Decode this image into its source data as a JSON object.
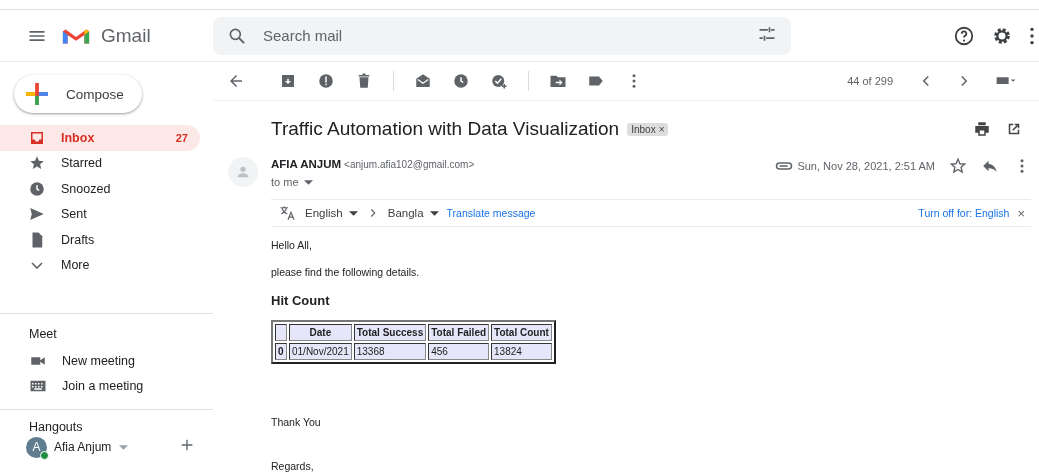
{
  "header": {
    "app_name": "Gmail",
    "search": {
      "placeholder": "Search mail"
    }
  },
  "sidebar": {
    "compose": "Compose",
    "items": [
      {
        "label": "Inbox",
        "count": "27",
        "selected": true
      },
      {
        "label": "Starred",
        "selected": false
      },
      {
        "label": "Snoozed",
        "selected": false
      },
      {
        "label": "Sent",
        "selected": false
      },
      {
        "label": "Drafts",
        "selected": false
      },
      {
        "label": "More",
        "selected": false
      }
    ],
    "meet": {
      "title": "Meet",
      "items": [
        "New meeting",
        "Join a meeting"
      ]
    },
    "hangouts": {
      "title": "Hangouts",
      "user": {
        "initial": "A",
        "name": "Afia Anjum",
        "online": true
      }
    }
  },
  "toolbar": {
    "pagination": "44 of 299"
  },
  "message": {
    "subject": "Traffic Automation with Data Visualization",
    "label": "Inbox",
    "label_close": "×",
    "sender_name": "AFIA ANJUM",
    "sender_email": "<anjum.afia102@gmail.com>",
    "recipient": "to me",
    "date": "Sun, Nov 28, 2021, 2:51 AM",
    "translate": {
      "from": "English",
      "to": "Bangla",
      "action": "Translate message",
      "turn_off": "Turn off for: English",
      "close": "×"
    },
    "body": {
      "greeting": "Hello All,",
      "intro": "please find the following details.",
      "heading": "Hit Count",
      "table": {
        "columns": [
          "Date",
          "Total Success",
          "Total Failed",
          "Total Count"
        ],
        "rows": [
          {
            "index": "0",
            "cells": [
              "01/Nov/2021",
              "13368",
              "456",
              "13824"
            ]
          }
        ]
      },
      "thanks": "Thank You",
      "closing": "Regards,"
    }
  }
}
